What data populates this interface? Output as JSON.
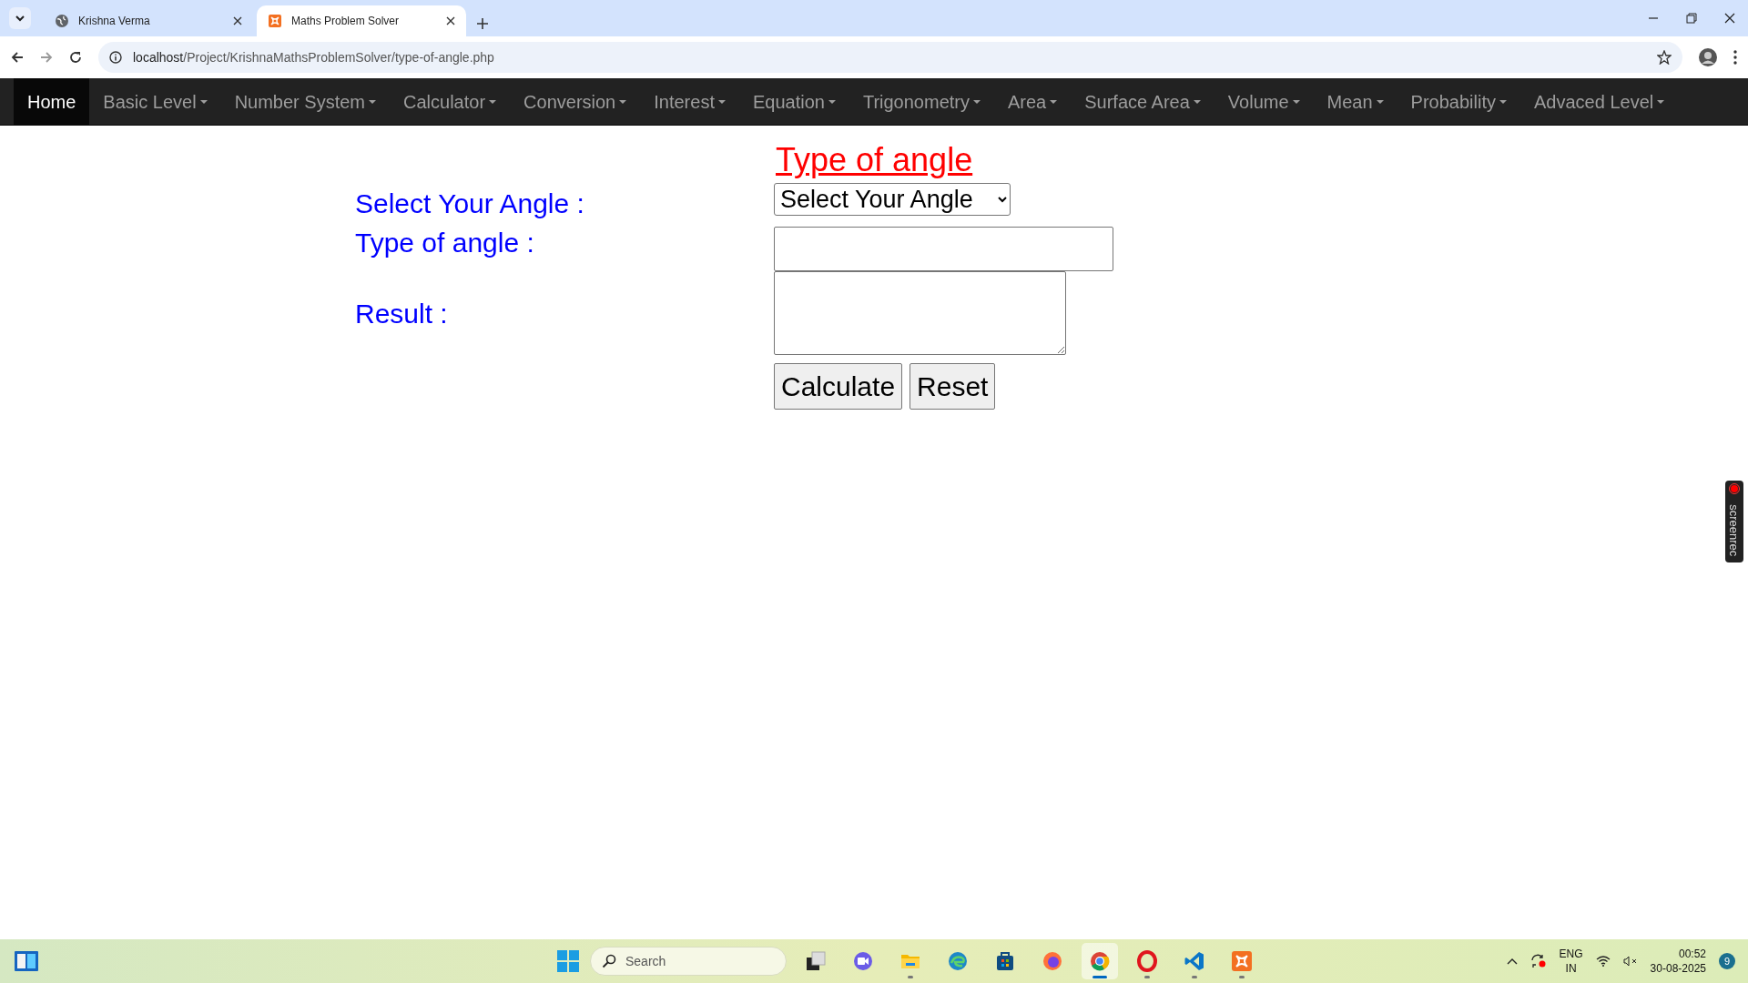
{
  "browser": {
    "tabs": [
      {
        "title": "Krishna Verma",
        "selected": false
      },
      {
        "title": "Maths Problem Solver",
        "selected": true
      }
    ],
    "url_host": "localhost",
    "url_path": "/Project/KrishnaMathsProblemSolver/type-of-angle.php"
  },
  "navbar": {
    "items": [
      {
        "label": "Home",
        "selected": true,
        "dropdown": false
      },
      {
        "label": "Basic Level",
        "selected": false,
        "dropdown": true
      },
      {
        "label": "Number System",
        "selected": false,
        "dropdown": true
      },
      {
        "label": "Calculator",
        "selected": false,
        "dropdown": true
      },
      {
        "label": "Conversion",
        "selected": false,
        "dropdown": true
      },
      {
        "label": "Interest",
        "selected": false,
        "dropdown": true
      },
      {
        "label": "Equation",
        "selected": false,
        "dropdown": true
      },
      {
        "label": "Trigonometry",
        "selected": false,
        "dropdown": true
      },
      {
        "label": "Area",
        "selected": false,
        "dropdown": true
      },
      {
        "label": "Surface Area",
        "selected": false,
        "dropdown": true
      },
      {
        "label": "Volume",
        "selected": false,
        "dropdown": true
      },
      {
        "label": "Mean",
        "selected": false,
        "dropdown": true
      },
      {
        "label": "Probability",
        "selected": false,
        "dropdown": true
      },
      {
        "label": "Advaced Level",
        "selected": false,
        "dropdown": true
      }
    ]
  },
  "page": {
    "title": "Type of angle",
    "fields": [
      {
        "label": "Select Your Angle :",
        "kind": "select",
        "value": "Select Your Angle"
      },
      {
        "label": "Type of angle :",
        "kind": "text"
      },
      {
        "label": "Result :",
        "kind": "textarea"
      }
    ],
    "buttons": [
      "Calculate",
      "Reset"
    ]
  },
  "recorder": {
    "label": "screenrec"
  },
  "taskbar": {
    "search_placeholder": "Search",
    "apps": [
      {
        "kind": "taskview",
        "running": false,
        "active": false
      },
      {
        "kind": "meet",
        "running": false,
        "active": false
      },
      {
        "kind": "folder",
        "running": true,
        "active": false
      },
      {
        "kind": "edge",
        "running": false,
        "active": false
      },
      {
        "kind": "store",
        "running": false,
        "active": false
      },
      {
        "kind": "firefox",
        "running": false,
        "active": false
      },
      {
        "kind": "chrome",
        "running": true,
        "active": true
      },
      {
        "kind": "opera",
        "running": true,
        "active": false
      },
      {
        "kind": "vscode",
        "running": true,
        "active": false
      },
      {
        "kind": "xampp",
        "running": true,
        "active": false
      }
    ],
    "language": "ENG",
    "region": "IN",
    "time": "00:52",
    "date": "30-08-2025",
    "notifications": "9"
  }
}
